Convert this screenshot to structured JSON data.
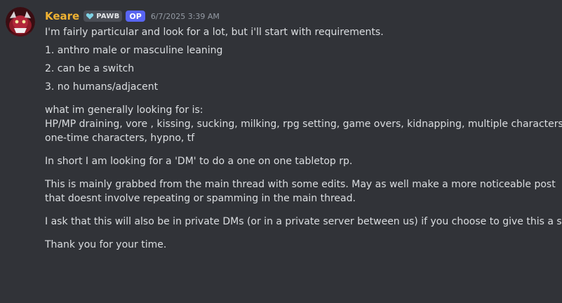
{
  "message": {
    "author": "Keare",
    "guild_tag": "PAWB",
    "op_badge": "OP",
    "timestamp": "6/7/2025 3:39 AM",
    "colors": {
      "background": "#313338",
      "username": "#f0b232",
      "text": "#dbdee1",
      "timestamp": "#949ba4",
      "op_badge": "#5865f2"
    },
    "lines": {
      "intro": "I'm fairly particular and look for a lot, but i'll start with requirements.",
      "req1": "1. anthro male or masculine leaning",
      "req2": "2. can be a switch",
      "req3": "3. no humans/adjacent",
      "looking_header": "what im generally looking for is:",
      "looking_list_1": "HP/MP draining, vore , kissing, sucking, milking, rpg setting, game overs, kidnapping, multiple characters,",
      "looking_list_2": "one-time characters, hypno, tf",
      "short": "In short I am looking for a 'DM' to do a one on one tabletop rp.",
      "grabbed_1": "This is mainly grabbed from the main thread with some edits. May as well make a more noticeable post",
      "grabbed_2": "that doesnt involve repeating or spamming in the main thread.",
      "private": "I ask that this will also be in private DMs (or in a private server between us) if you choose to give this a shot.",
      "thanks": "Thank you for your time."
    }
  }
}
